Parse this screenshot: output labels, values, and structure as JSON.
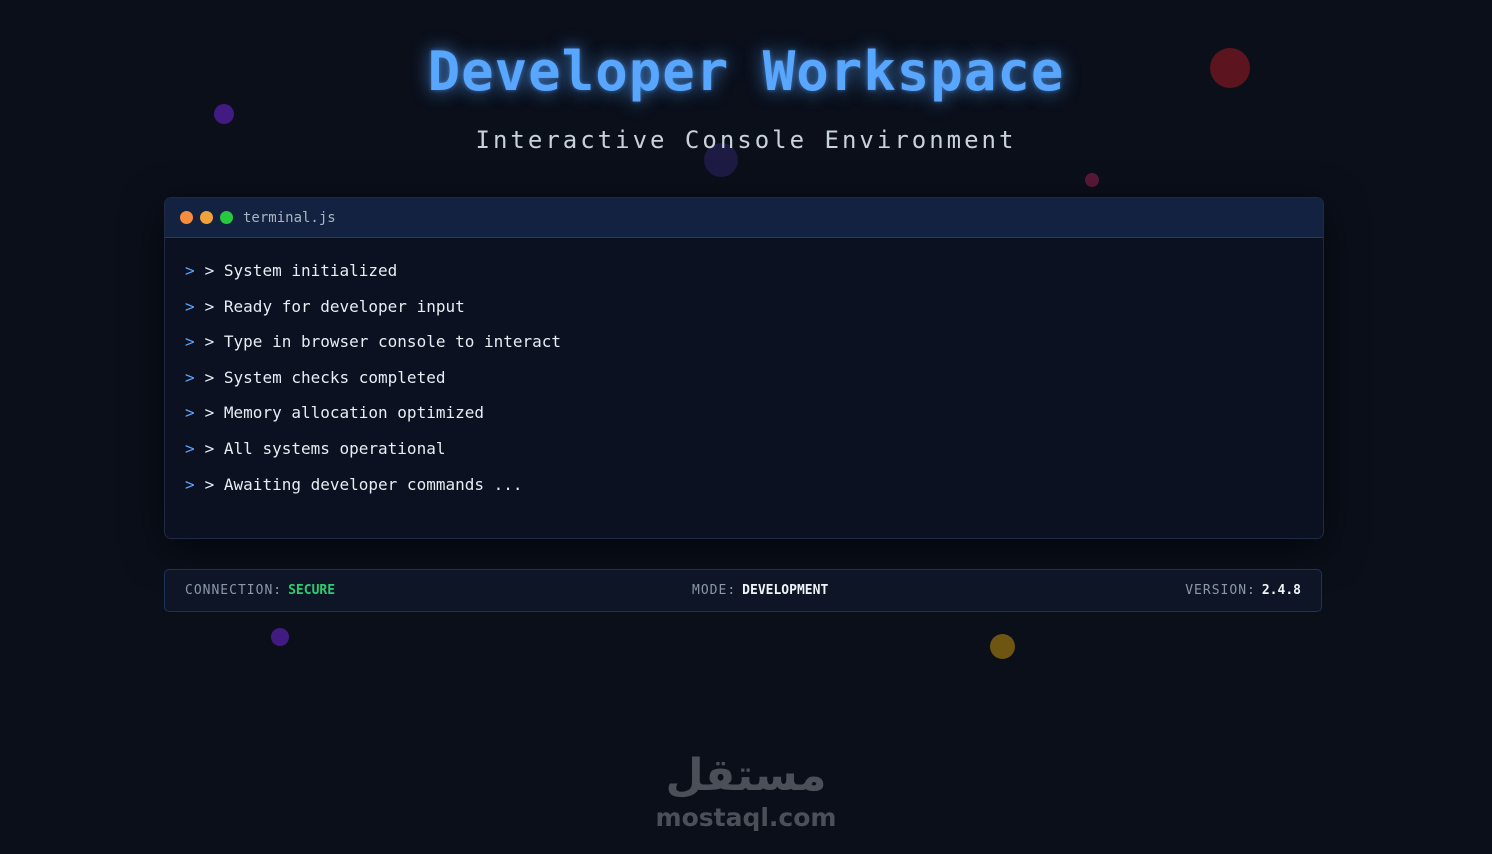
{
  "header": {
    "title": "Developer Workspace",
    "subtitle": "Interactive Console Environment"
  },
  "terminal": {
    "filename": "terminal.js",
    "prompt_symbol": ">",
    "lines": [
      "> System initialized",
      "> Ready for developer input",
      "> Type in browser console to interact",
      "> System checks completed",
      "> Memory allocation optimized",
      "> All systems operational",
      "> Awaiting developer commands ..."
    ]
  },
  "status": {
    "connection_label": "CONNECTION:",
    "connection_value": "SECURE",
    "mode_label": "MODE:",
    "mode_value": "DEVELOPMENT",
    "version_label": "VERSION:",
    "version_value": "2.4.8"
  },
  "watermark": {
    "arabic": "مستقل",
    "latin": "mostaql.com"
  },
  "colors": {
    "background": "#0a0f1a",
    "accent": "#58a6ff",
    "secure": "#2ecc71",
    "window_close": "#f78c3c",
    "window_minimize": "#f0a13a",
    "window_maximize": "#27c93f"
  }
}
